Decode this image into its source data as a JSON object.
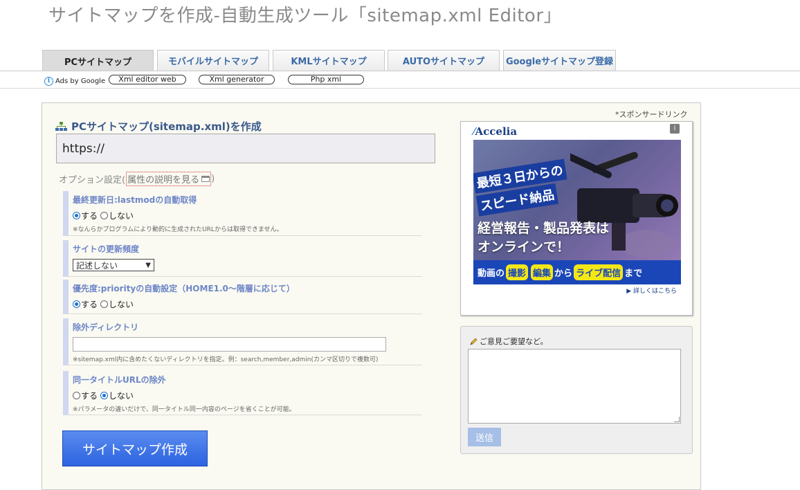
{
  "page": {
    "title": "サイトマップを作成-自動生成ツール「sitemap.xml Editor」"
  },
  "tabs": [
    {
      "label": "PCサイトマップ"
    },
    {
      "label": "モバイルサイトマップ"
    },
    {
      "label": "KMLサイトマップ"
    },
    {
      "label": "AUTOサイトマップ"
    },
    {
      "label": "Googleサイトマップ登録"
    }
  ],
  "ad_links": {
    "ads_by": "Ads by Google",
    "items": [
      {
        "label": "Xml editor web"
      },
      {
        "label": "Xml generator"
      },
      {
        "label": "Php xml"
      }
    ]
  },
  "form": {
    "heading": "PCサイトマップ(sitemap.xml)を作成",
    "url_value": "https://",
    "options_label": "オプション設定(",
    "options_link": "属性の説明を見る",
    "options_close": ")",
    "sections": {
      "lastmod": {
        "title": "最終更新日:lastmodの自動取得",
        "yes": "する",
        "no": "しない",
        "selected": "yes",
        "note": "※なんらかプログラムにより動的に生成されたURLからは取得できません。"
      },
      "changefreq": {
        "title": "サイトの更新頻度",
        "select_value": "記述しない"
      },
      "priority": {
        "title": "優先度:priorityの自動設定（HOME1.0〜階層に応じて）",
        "yes": "する",
        "no": "しない",
        "selected": "yes"
      },
      "exclude": {
        "title": "除外ディレクトリ",
        "value": "",
        "note": "※sitemap.xml内に含めたくないディレクトリを指定。例：search,member,admin(カンマ区切りで複数可)"
      },
      "dup_title": {
        "title": "同一タイトルURLの除外",
        "yes": "する",
        "no": "しない",
        "selected": "no",
        "note": "※パラメータの違いだけで、同一タイトル同一内容のページを省くことが可能。"
      }
    },
    "submit_label": "サイトマップ作成"
  },
  "sponsor": {
    "label": "*スポンサードリンク",
    "logo": "Accelia",
    "badge_line1": "最短３日からの",
    "badge_line2": "スピード納品",
    "headline_line1": "経営報告・製品発表は",
    "headline_line2": "オンラインで！",
    "band": {
      "p1": "動画の",
      "h1": "撮影",
      "h2": "編集",
      "p2": "から",
      "h3": "ライブ配信",
      "p3": "まで"
    },
    "more": "▶ 詳しくはこちら"
  },
  "feedback": {
    "label": "ご意見ご要望など。",
    "value": "",
    "send_label": "送信"
  },
  "colors": {
    "accent_blue": "#2c63e0",
    "heading_blue": "#3b5a8c",
    "section_blue": "#6e86c8",
    "ad_blue": "#1b46b8",
    "ad_yellow": "#f3e816"
  }
}
